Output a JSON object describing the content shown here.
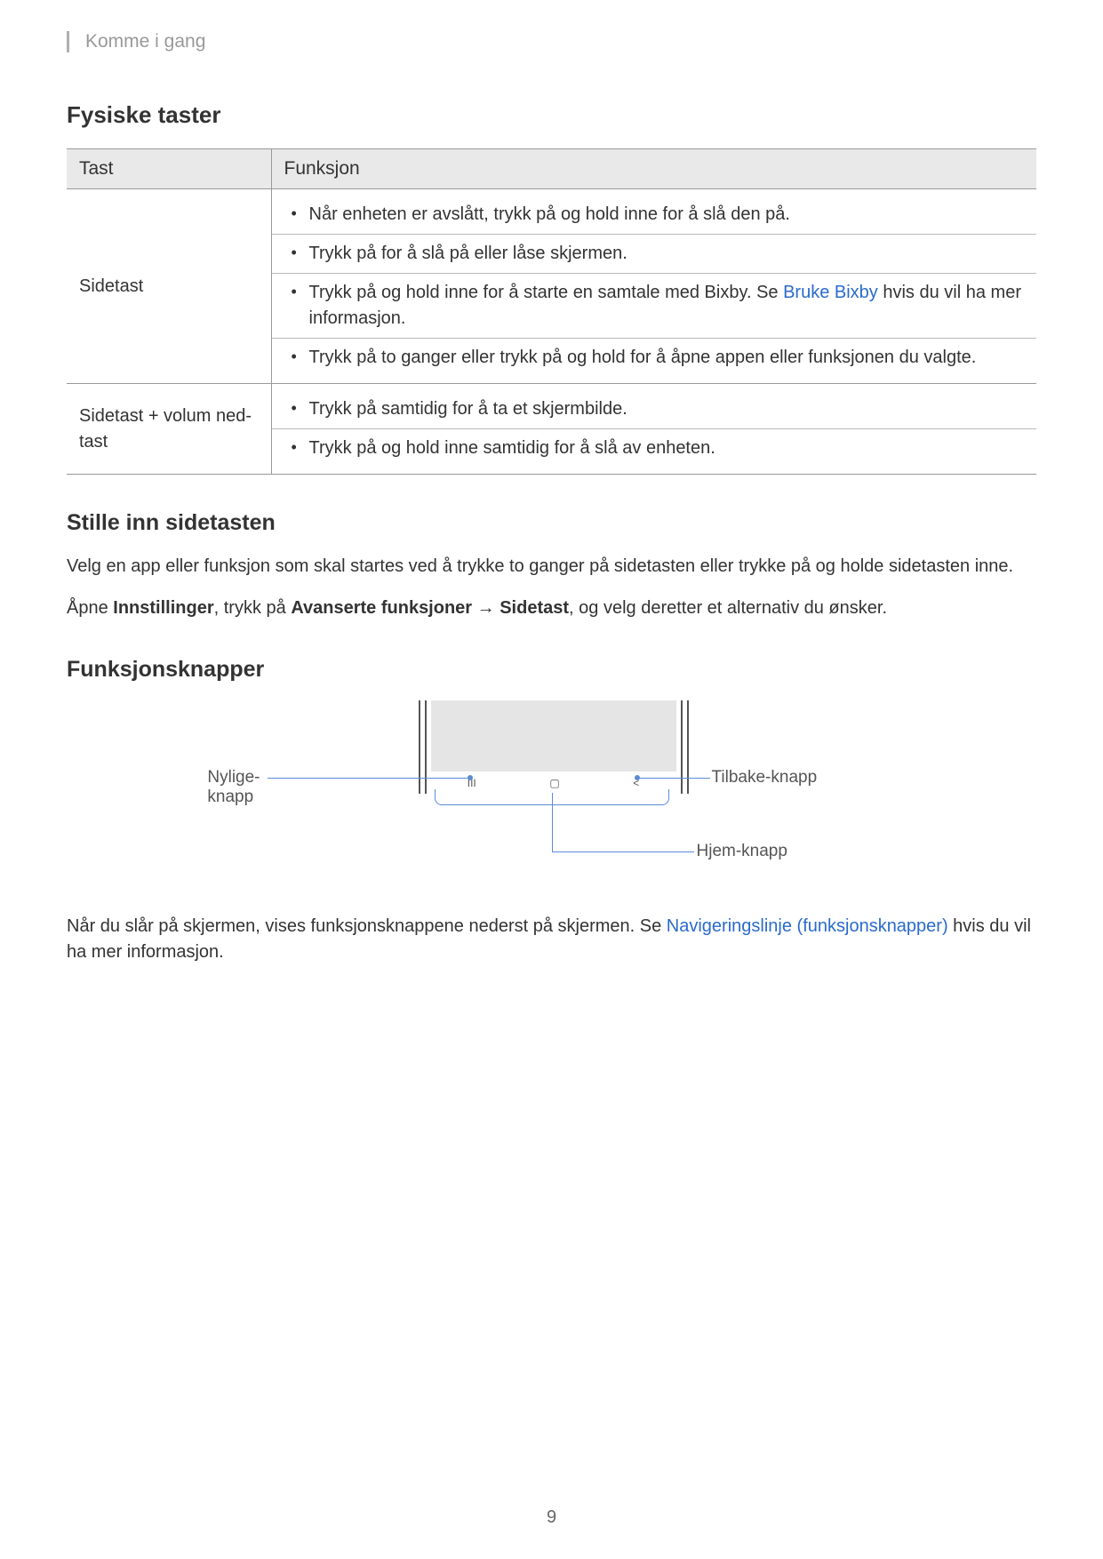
{
  "breadcrumb": "Komme i gang",
  "section_title": "Fysiske taster",
  "table": {
    "header_key": "Tast",
    "header_func": "Funksjon",
    "row1_key": "Sidetast",
    "row1_items": {
      "a": "Når enheten er avslått, trykk på og hold inne for å slå den på.",
      "b": "Trykk på for å slå på eller låse skjermen.",
      "c_prefix": "Trykk på og hold inne for å starte en samtale med Bixby. Se ",
      "c_link": "Bruke Bixby",
      "c_suffix": " hvis du vil ha mer informasjon.",
      "d": "Trykk på to ganger eller trykk på og hold for å åpne appen eller funksjonen du valgte."
    },
    "row2_key": "Sidetast + volum ned-tast",
    "row2_items": {
      "a": "Trykk på samtidig for å ta et skjermbilde.",
      "b": "Trykk på og hold inne samtidig for å slå av enheten."
    }
  },
  "sidetast_title": "Stille inn sidetasten",
  "sidetast_p1": "Velg en app eller funksjon som skal startes ved å trykke to ganger på sidetasten eller trykke på og holde sidetasten inne.",
  "sidetast_p2_pre": "Åpne ",
  "sidetast_p2_b1": "Innstillinger",
  "sidetast_p2_mid1": ", trykk på ",
  "sidetast_p2_b2": "Avanserte funksjoner",
  "sidetast_p2_arrow": " → ",
  "sidetast_p2_b3": "Sidetast",
  "sidetast_p2_suffix": ", og velg deretter et alternativ du ønsker.",
  "funcbuttons_title": "Funksjonsknapper",
  "diagram_labels": {
    "recent": "Nylige-knapp",
    "back": "Tilbake-knapp",
    "home": "Hjem-knapp"
  },
  "nav_icons": {
    "recent": "III",
    "home": "▢",
    "back": "<"
  },
  "funcbuttons_p_prefix": "Når du slår på skjermen, vises funksjonsknappene nederst på skjermen. Se ",
  "funcbuttons_p_link": "Navigeringslinje (funksjonsknapper)",
  "funcbuttons_p_suffix": " hvis du vil ha mer informasjon.",
  "page_number": "9"
}
